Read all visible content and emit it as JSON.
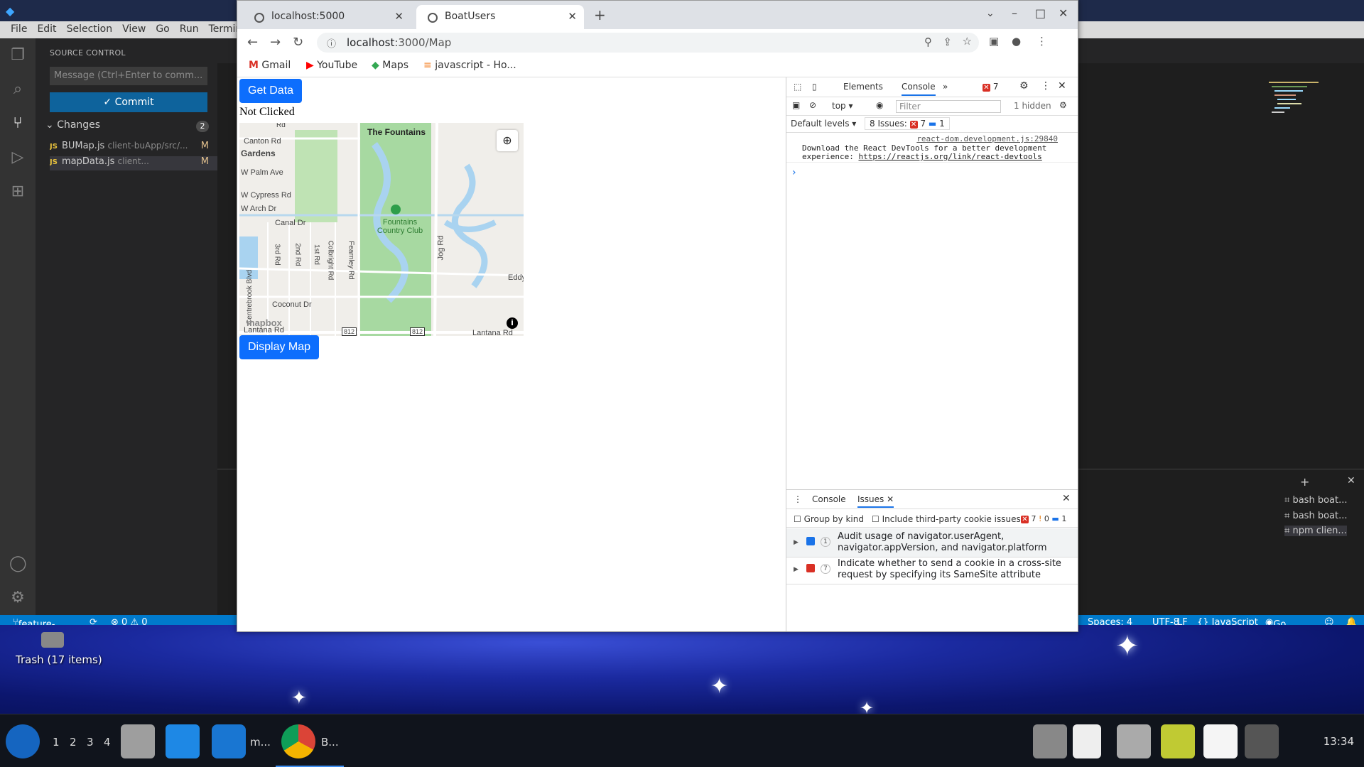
{
  "vscode": {
    "menu": [
      "File",
      "Edit",
      "Selection",
      "View",
      "Go",
      "Run",
      "Terminal"
    ],
    "source_control": {
      "title": "SOURCE CONTROL",
      "message_placeholder": "Message (Ctrl+Enter to comm...",
      "commit_label": "✓ Commit",
      "changes_label": "Changes",
      "changes_count": "2",
      "files": [
        {
          "name": "BUMap.js",
          "path": "client-buApp/src/...",
          "status": "M"
        },
        {
          "name": "mapData.js",
          "path": "client...",
          "status": "M"
        }
      ]
    },
    "status": {
      "branch": "feature-two*",
      "problems": "⊗ 0 ⚠ 0",
      "spaces": "Spaces: 4",
      "encoding": "UTF-8",
      "eol": "LF",
      "language": "{} JavaScript",
      "golive": "Go Live"
    },
    "terminals": [
      "bash boat...",
      "bash boat...",
      "npm clien..."
    ]
  },
  "chrome": {
    "tabs": [
      {
        "title": "localhost:5000",
        "active": false
      },
      {
        "title": "BoatUsers",
        "active": true
      }
    ],
    "url_host": "localhost",
    "url_rest": ":3000/Map",
    "bookmarks": [
      "Gmail",
      "YouTube",
      "Maps",
      "javascript - Ho..."
    ],
    "page": {
      "get_data_label": "Get Data",
      "status_text": "Not Clicked",
      "display_map_label": "Display Map",
      "map_labels": {
        "title": "The Fountains",
        "canton": "Canton Rd",
        "gardens": "Gardens",
        "palm": "W Palm Ave",
        "cypress": "W Cypress Rd",
        "arch": "W Arch Dr",
        "canal": "Canal Dr",
        "club": "Fountains Country Club",
        "jog": "Jog Rd",
        "third": "3rd Rd",
        "second": "2nd Rd",
        "first": "1st Rd",
        "colbright": "Colbright Rd",
        "fearnley": "Fearnley Rd",
        "centrebrook": "Centrebrook Blvd",
        "coconut": "Coconut Dr",
        "lantana": "Lantana Rd",
        "lantana2": "Lantana Rd",
        "eddy": "Eddy",
        "route1": "812",
        "route2": "812",
        "mapbox": "mapbox",
        "rd_top": "Rd"
      }
    },
    "devtools": {
      "tabs": [
        "Elements",
        "Console"
      ],
      "error_count": "7",
      "context": "top",
      "filter_placeholder": "Filter",
      "hidden": "1 hidden",
      "levels": "Default levels",
      "issues_summary": "8 Issues:",
      "issues_err": "7",
      "issues_info": "1",
      "console_source": "react-dom.development.js:29840",
      "console_msg_1": "Download the React DevTools for a better development",
      "console_msg_2": "experience: ",
      "console_link": "https://reactjs.org/link/react-devtools",
      "prompt": "›",
      "drawer_tabs": [
        "Console",
        "Issues"
      ],
      "group_by_kind": "Group by kind",
      "third_party": "Include third-party cookie issues",
      "counts": {
        "err": "7",
        "warn": "0",
        "info": "1"
      },
      "issues": [
        {
          "count": "1",
          "kind": "info",
          "line1": "Audit usage of navigator.userAgent,",
          "line2": "navigator.appVersion, and navigator.platform"
        },
        {
          "count": "7",
          "kind": "error",
          "line1": "Indicate whether to send a cookie in a cross-site",
          "line2": "request by specifying its SameSite attribute"
        }
      ]
    }
  },
  "desktop": {
    "trash": "Trash (17 items)",
    "workspaces": [
      "1",
      "2",
      "3",
      "4"
    ],
    "task_vscode": "m...",
    "task_chrome": "B...",
    "clock": "13:34"
  },
  "colors": {
    "vscode_blue": "#007acc",
    "bootstrap_primary": "#0d6efd",
    "error_red": "#d93025"
  }
}
